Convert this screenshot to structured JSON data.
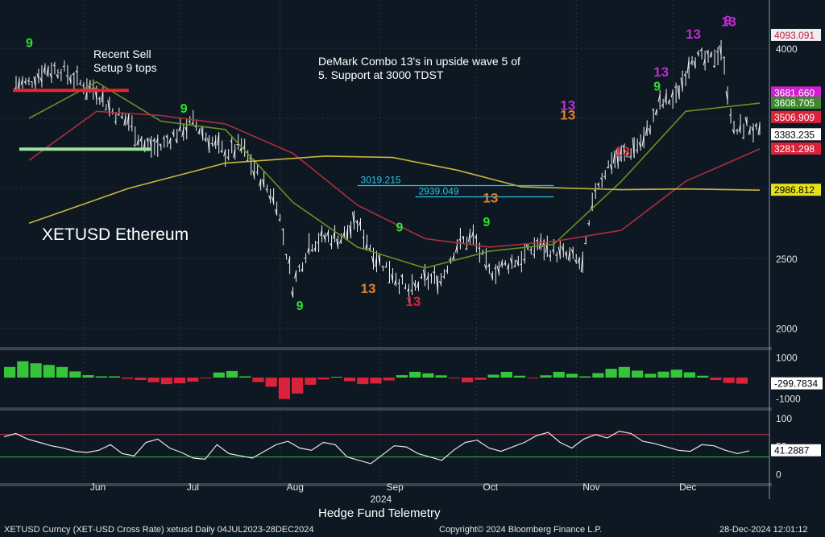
{
  "chart_data": {
    "type": "line",
    "subtype": "daily-bar",
    "instrument": "XETUSD Ethereum",
    "title_lines": [
      "Recent Sell",
      "Setup 9 tops"
    ],
    "annotation_lines": [
      "DeMark Combo 13's in upside wave 5 of",
      "5.  Support at 3000 TDST"
    ],
    "credit": "Hedge Fund Telemetry",
    "footer_left": "XETUSD Curncy (XET-USD Cross Rate) xetusd  Daily 04JUL2023-28DEC2024",
    "footer_center": "Copyright© 2024 Bloomberg Finance L.P.",
    "footer_right": "28-Dec-2024 12:01:12",
    "x_month_labels": [
      "Jun",
      "Jul",
      "Aug",
      "Sep",
      "Oct",
      "Nov",
      "Dec"
    ],
    "x_year_label": "2024",
    "price_axis": {
      "ticks": [
        2000,
        2500,
        3000,
        3500,
        4000
      ],
      "ylim": [
        1900,
        4300
      ],
      "scale": "linear"
    },
    "price_series": {
      "name": "XETUSD",
      "points": [
        [
          "2024-05-15",
          3750
        ],
        [
          "2024-05-20",
          3850
        ],
        [
          "2024-05-25",
          3850
        ],
        [
          "2024-05-31",
          3750
        ],
        [
          "2024-06-05",
          3700
        ],
        [
          "2024-06-10",
          3550
        ],
        [
          "2024-06-15",
          3480
        ],
        [
          "2024-06-20",
          3300
        ],
        [
          "2024-06-25",
          3300
        ],
        [
          "2024-06-30",
          3400
        ],
        [
          "2024-07-05",
          3470
        ],
        [
          "2024-07-10",
          3350
        ],
        [
          "2024-07-15",
          3250
        ],
        [
          "2024-07-20",
          3300
        ],
        [
          "2024-07-25",
          3100
        ],
        [
          "2024-07-31",
          2900
        ],
        [
          "2024-08-05",
          2300
        ],
        [
          "2024-08-10",
          2600
        ],
        [
          "2024-08-15",
          2650
        ],
        [
          "2024-08-20",
          2650
        ],
        [
          "2024-08-25",
          2750
        ],
        [
          "2024-08-31",
          2500
        ],
        [
          "2024-09-05",
          2400
        ],
        [
          "2024-09-10",
          2250
        ],
        [
          "2024-09-15",
          2350
        ],
        [
          "2024-09-20",
          2350
        ],
        [
          "2024-09-25",
          2600
        ],
        [
          "2024-09-30",
          2650
        ],
        [
          "2024-10-05",
          2400
        ],
        [
          "2024-10-10",
          2450
        ],
        [
          "2024-10-15",
          2500
        ],
        [
          "2024-10-20",
          2600
        ],
        [
          "2024-10-25",
          2550
        ],
        [
          "2024-10-31",
          2500
        ],
        [
          "2024-11-03",
          2450
        ],
        [
          "2024-11-07",
          3000
        ],
        [
          "2024-11-12",
          3200
        ],
        [
          "2024-11-17",
          3250
        ],
        [
          "2024-11-22",
          3350
        ],
        [
          "2024-11-27",
          3600
        ],
        [
          "2024-12-02",
          3650
        ],
        [
          "2024-12-07",
          3950
        ],
        [
          "2024-12-12",
          3900
        ],
        [
          "2024-12-16",
          4000
        ],
        [
          "2024-12-20",
          3400
        ],
        [
          "2024-12-24",
          3450
        ],
        [
          "2024-12-28",
          3383.235
        ]
      ]
    },
    "overlays": [
      {
        "name": "MA short",
        "color": "#6b8e23",
        "points": [
          [
            "2024-05-15",
            3500
          ],
          [
            "2024-06-05",
            3760
          ],
          [
            "2024-06-25",
            3480
          ],
          [
            "2024-07-15",
            3420
          ],
          [
            "2024-08-05",
            2900
          ],
          [
            "2024-08-25",
            2580
          ],
          [
            "2024-09-15",
            2430
          ],
          [
            "2024-10-05",
            2550
          ],
          [
            "2024-10-25",
            2600
          ],
          [
            "2024-11-15",
            3050
          ],
          [
            "2024-12-05",
            3550
          ],
          [
            "2024-12-28",
            3608.705
          ]
        ]
      },
      {
        "name": "MA mid",
        "color": "#b02e3a",
        "points": [
          [
            "2024-05-15",
            3200
          ],
          [
            "2024-06-05",
            3550
          ],
          [
            "2024-06-25",
            3520
          ],
          [
            "2024-07-15",
            3460
          ],
          [
            "2024-08-05",
            3250
          ],
          [
            "2024-08-25",
            2880
          ],
          [
            "2024-09-15",
            2640
          ],
          [
            "2024-10-05",
            2580
          ],
          [
            "2024-10-25",
            2620
          ],
          [
            "2024-11-15",
            2700
          ],
          [
            "2024-12-05",
            3050
          ],
          [
            "2024-12-28",
            3281.298
          ]
        ]
      },
      {
        "name": "MA long",
        "color": "#c9b63a",
        "points": [
          [
            "2024-05-15",
            2750
          ],
          [
            "2024-06-15",
            3000
          ],
          [
            "2024-07-15",
            3180
          ],
          [
            "2024-08-15",
            3230
          ],
          [
            "2024-09-05",
            3220
          ],
          [
            "2024-09-25",
            3130
          ],
          [
            "2024-10-15",
            3010
          ],
          [
            "2024-11-15",
            2990
          ],
          [
            "2024-12-05",
            2995
          ],
          [
            "2024-12-28",
            2986.812
          ]
        ]
      }
    ],
    "levels": [
      {
        "label": "3019.215",
        "value": 3019.215,
        "color": "#29c3e0"
      },
      {
        "label": "2939.049",
        "value": 2939.049,
        "color": "#29c3e0"
      }
    ],
    "right_tags": [
      {
        "label": "4093.091",
        "value": 4093.091,
        "bg": "#efefef",
        "fg": "#c21b40"
      },
      {
        "label": "3681.660",
        "value": 3681.66,
        "bg": "#d11fd1",
        "fg": "#ffffff"
      },
      {
        "label": "3608.705",
        "value": 3608.705,
        "bg": "#3c8a2c",
        "fg": "#ffffff"
      },
      {
        "label": "3506.909",
        "value": 3506.909,
        "bg": "#d8233a",
        "fg": "#ffffff"
      },
      {
        "label": "3383.235",
        "value": 3383.235,
        "bg": "#ffffff",
        "fg": "#000000"
      },
      {
        "label": "3281.298",
        "value": 3281.298,
        "bg": "#d8233a",
        "fg": "#ffffff"
      },
      {
        "label": "2986.812",
        "value": 2986.812,
        "bg": "#e7e11c",
        "fg": "#000000"
      }
    ],
    "markers": [
      {
        "text": "9",
        "date": "2024-05-14",
        "value": 4010,
        "color": "#2ee02e"
      },
      {
        "text": "9",
        "date": "2024-07-01",
        "value": 3540,
        "color": "#2ee02e"
      },
      {
        "text": "9",
        "date": "2024-08-06",
        "value": 2130,
        "color": "#2ee02e"
      },
      {
        "text": "9",
        "date": "2024-09-06",
        "value": 2690,
        "color": "#2ee02e"
      },
      {
        "text": "13",
        "date": "2024-08-26",
        "value": 2250,
        "color": "#e1812a"
      },
      {
        "text": "13",
        "date": "2024-09-09",
        "value": 2160,
        "color": "#d8233a"
      },
      {
        "text": "13",
        "date": "2024-10-03",
        "value": 2900,
        "color": "#e1812a"
      },
      {
        "text": "13",
        "date": "2024-10-27",
        "value": 3490,
        "color": "#e1812a"
      },
      {
        "text": "13",
        "date": "2024-10-27",
        "value": 3560,
        "color": "#c02ad1"
      },
      {
        "text": "13",
        "date": "2024-11-13",
        "value": 3230,
        "color": "#d8233a"
      },
      {
        "text": "13",
        "date": "2024-11-25",
        "value": 3800,
        "color": "#c02ad1"
      },
      {
        "text": "13",
        "date": "2024-12-05",
        "value": 4070,
        "color": "#c02ad1"
      },
      {
        "text": "13",
        "date": "2024-12-16",
        "value": 4160,
        "color": "#c02ad1"
      },
      {
        "text": "9",
        "date": "2024-12-17",
        "value": 4170,
        "color": "#c02ad1"
      },
      {
        "text": "9",
        "date": "2024-11-25",
        "value": 3700,
        "color": "#2ee02e"
      },
      {
        "text": "9",
        "date": "2024-10-03",
        "value": 2730,
        "color": "#2ee02e"
      }
    ],
    "osc1": {
      "ticks": [
        1000,
        -1000
      ],
      "ylim": [
        -1300,
        1300
      ],
      "last": "-299.7834",
      "values": [
        520,
        800,
        700,
        620,
        520,
        300,
        120,
        60,
        60,
        -60,
        -120,
        -230,
        -320,
        -280,
        -200,
        -40,
        250,
        320,
        60,
        -220,
        -450,
        -1050,
        -780,
        -350,
        -90,
        40,
        -180,
        -320,
        -290,
        -140,
        120,
        280,
        210,
        110,
        -40,
        -230,
        -110,
        140,
        280,
        90,
        -40,
        110,
        280,
        190,
        60,
        220,
        430,
        520,
        340,
        190,
        290,
        390,
        260,
        90,
        -120,
        -260,
        -300
      ]
    },
    "osc2": {
      "ticks": [
        100,
        50,
        0
      ],
      "ylim": [
        -8,
        110
      ],
      "last": "41.2887",
      "upper": 70,
      "lower": 30,
      "values": [
        66,
        72,
        62,
        56,
        50,
        46,
        40,
        38,
        42,
        52,
        36,
        32,
        56,
        62,
        46,
        38,
        28,
        26,
        52,
        36,
        32,
        28,
        40,
        52,
        58,
        46,
        42,
        56,
        52,
        30,
        24,
        18,
        34,
        50,
        48,
        36,
        30,
        24,
        42,
        56,
        60,
        46,
        40,
        48,
        56,
        68,
        74,
        56,
        46,
        62,
        70,
        64,
        76,
        72,
        58,
        54,
        48,
        42,
        40,
        52,
        50,
        42,
        36,
        41
      ]
    }
  }
}
